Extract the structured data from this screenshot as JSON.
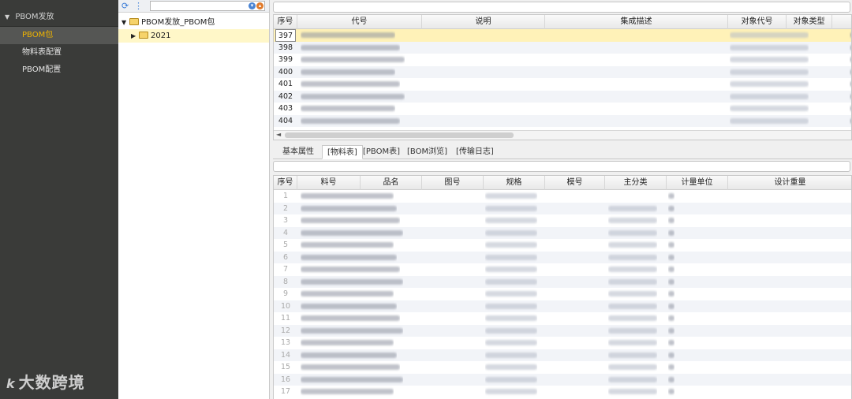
{
  "nav": {
    "header": "PBOM发放",
    "items": [
      {
        "label": "PBOM包",
        "active": true
      },
      {
        "label": "物料表配置",
        "active": false
      },
      {
        "label": "PBOM配置",
        "active": false
      }
    ]
  },
  "watermark": {
    "logo": "k",
    "text": "大数跨境"
  },
  "tree": {
    "root_label": "PBOM发放_PBOM包",
    "child_label": "2021"
  },
  "top_grid": {
    "columns": [
      "序号",
      "代号",
      "说明",
      "集成描述",
      "对象代号",
      "对象类型"
    ],
    "rows": [
      "397",
      "398",
      "399",
      "400",
      "401",
      "402",
      "403",
      "404"
    ],
    "selected_row": "397"
  },
  "tabs": [
    "基本属性",
    "[物料表]",
    "[PBOM表]",
    "[BOM浏览]",
    "[传输日志]"
  ],
  "active_tab": "[物料表]",
  "bottom_grid": {
    "columns": [
      "序号",
      "料号",
      "品名",
      "图号",
      "规格",
      "模号",
      "主分类",
      "计量单位",
      "设计重量"
    ],
    "rows": [
      "1",
      "2",
      "3",
      "4",
      "5",
      "6",
      "7",
      "8",
      "9",
      "10",
      "11",
      "12",
      "13",
      "14",
      "15",
      "16",
      "17"
    ]
  },
  "colors": {
    "nav_bg": "#3a3b39",
    "active_nav_text": "#f0b400",
    "selected_row": "#fff2b8"
  }
}
